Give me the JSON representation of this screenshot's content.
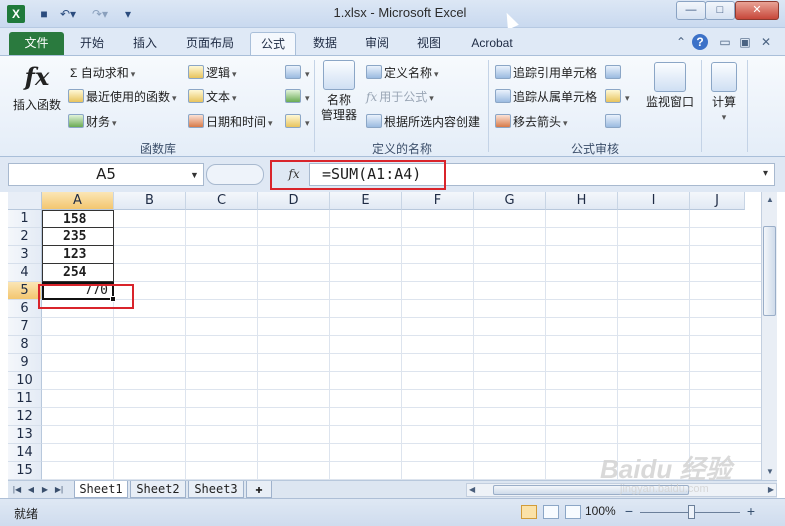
{
  "window": {
    "app_icon": "X",
    "title": "1.xlsx  -  Microsoft Excel",
    "qat": [
      "save-icon",
      "undo-icon",
      "redo-icon",
      "customize-icon"
    ]
  },
  "tabs": [
    {
      "label": "文件"
    },
    {
      "label": "开始"
    },
    {
      "label": "插入"
    },
    {
      "label": "页面布局"
    },
    {
      "label": "公式"
    },
    {
      "label": "数据"
    },
    {
      "label": "审阅"
    },
    {
      "label": "视图"
    },
    {
      "label": "Acrobat"
    }
  ],
  "ribbon": {
    "function_library": {
      "insert_function": "插入函数",
      "fx_symbol": "fx",
      "autosum": "Σ 自动求和",
      "recent": "最近使用的函数",
      "financial": "财务",
      "logical": "逻辑",
      "text": "文本",
      "datetime": "日期和时间",
      "label": "函数库"
    },
    "defined_names": {
      "name_manager_1": "名称",
      "name_manager_2": "管理器",
      "define_name": "定义名称",
      "use_in_formula": "用于公式",
      "create_from_selection": "根据所选内容创建",
      "label": "定义的名称"
    },
    "formula_auditing": {
      "trace_precedents": "追踪引用单元格",
      "trace_dependents": "追踪从属单元格",
      "remove_arrows": "移去箭头",
      "watch_window": "监视窗口",
      "label": "公式审核"
    },
    "calculation": {
      "label": "计算"
    }
  },
  "formula_bar": {
    "name_box": "A5",
    "fx": "fx",
    "formula": "=SUM(A1:A4)"
  },
  "grid": {
    "columns": [
      "A",
      "B",
      "C",
      "D",
      "E",
      "F",
      "G",
      "H",
      "I",
      "J"
    ],
    "rows": [
      "1",
      "2",
      "3",
      "4",
      "5",
      "6",
      "7",
      "8",
      "9",
      "10",
      "11",
      "12",
      "13",
      "14",
      "15"
    ],
    "cells": {
      "A1": "158",
      "A2": "235",
      "A3": "123",
      "A4": "254",
      "A5": "770"
    },
    "active_cell": "A5"
  },
  "sheets": [
    "Sheet1",
    "Sheet2",
    "Sheet3"
  ],
  "active_sheet": "Sheet1",
  "status": {
    "text": "就绪",
    "zoom": "100%"
  },
  "watermark": {
    "main": "Baidu 经验",
    "sub": "jingyan.baidu.com"
  },
  "colors": {
    "file_tab": "#2a7a3e",
    "highlight_box": "#d9242b",
    "selected_header": "#f3c66f"
  }
}
